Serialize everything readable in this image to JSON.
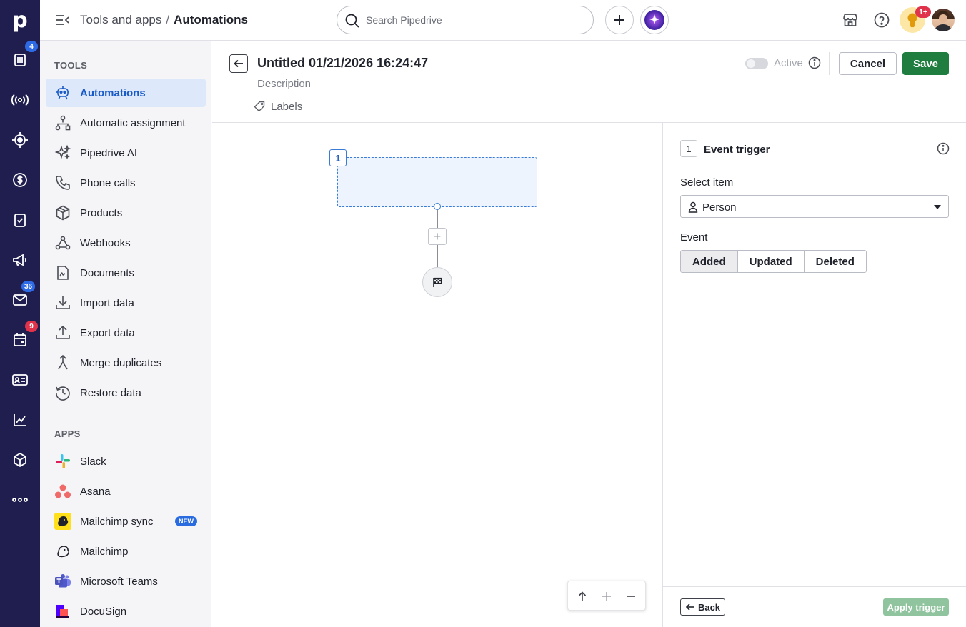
{
  "rail": {
    "logo": "p",
    "badges": {
      "leads": "4",
      "mail": "36",
      "calendar": "9"
    }
  },
  "header": {
    "crumb_parent": "Tools and apps",
    "crumb_sep": "/",
    "crumb_current": "Automations",
    "search_placeholder": "Search Pipedrive",
    "notification_badge": "1+"
  },
  "sidebar": {
    "tools_title": "TOOLS",
    "tools": [
      {
        "label": "Automations"
      },
      {
        "label": "Automatic assignment"
      },
      {
        "label": "Pipedrive AI"
      },
      {
        "label": "Phone calls"
      },
      {
        "label": "Products"
      },
      {
        "label": "Webhooks"
      },
      {
        "label": "Documents"
      },
      {
        "label": "Import data"
      },
      {
        "label": "Export data"
      },
      {
        "label": "Merge duplicates"
      },
      {
        "label": "Restore data"
      }
    ],
    "apps_title": "APPS",
    "apps": [
      {
        "label": "Slack"
      },
      {
        "label": "Asana"
      },
      {
        "label": "Mailchimp sync",
        "badge": "NEW"
      },
      {
        "label": "Mailchimp"
      },
      {
        "label": "Microsoft Teams"
      },
      {
        "label": "DocuSign"
      }
    ]
  },
  "automation": {
    "title": "Untitled 01/21/2026 16:24:47",
    "description_placeholder": "Description",
    "labels": "Labels",
    "active_label": "Active",
    "cancel": "Cancel",
    "save": "Save"
  },
  "canvas": {
    "node_number": "1",
    "add_step": "+"
  },
  "panel": {
    "step_number": "1",
    "title": "Event trigger",
    "select_item_label": "Select item",
    "select_item_value": "Person",
    "event_label": "Event",
    "events": [
      "Added",
      "Updated",
      "Deleted"
    ],
    "selected_event": "Added",
    "back": "Back",
    "apply": "Apply trigger"
  },
  "colors": {
    "rail_bg": "#1f1e4e",
    "active_nav_bg": "#dde9fb",
    "active_nav_text": "#1a5ac5",
    "save_green": "#1f7d3f",
    "apply_disabled": "#8fc49e",
    "node_blue": "#3a7bd5"
  }
}
